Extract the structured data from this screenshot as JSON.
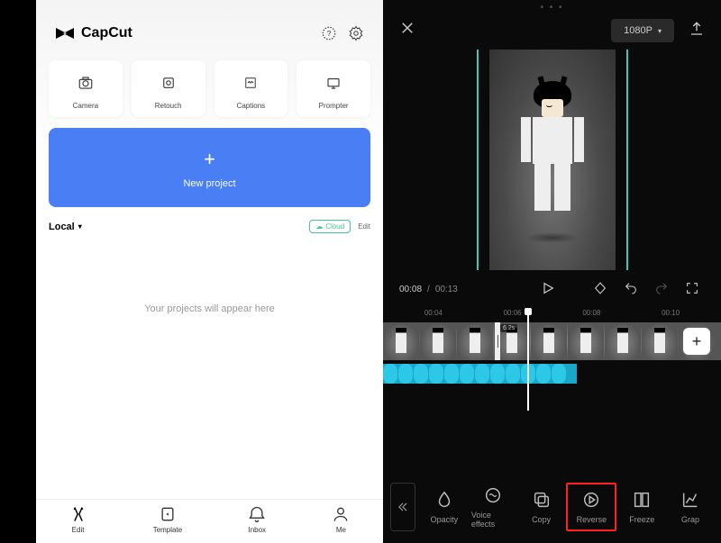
{
  "capcut": {
    "app_name": "CapCut",
    "tools": [
      {
        "label": "Camera",
        "icon": "camera-icon"
      },
      {
        "label": "Retouch",
        "icon": "retouch-icon"
      },
      {
        "label": "Captions",
        "icon": "captions-icon"
      },
      {
        "label": "Prompter",
        "icon": "prompter-icon"
      }
    ],
    "new_project_label": "New project",
    "local_label": "Local",
    "cloud_label": "Cloud",
    "edit_label": "Edit",
    "empty_message": "Your projects will appear here",
    "nav": [
      {
        "label": "Edit",
        "icon": "edit-icon"
      },
      {
        "label": "Template",
        "icon": "template-icon"
      },
      {
        "label": "Inbox",
        "icon": "inbox-icon"
      },
      {
        "label": "Me",
        "icon": "me-icon"
      }
    ]
  },
  "editor": {
    "resolution": "1080P",
    "time_current": "00:08",
    "time_total": "00:13",
    "ruler": [
      "00:04",
      "00:06",
      "00:08",
      "00:10"
    ],
    "clip_duration": "6.2s",
    "toolbar": [
      {
        "label": "Opacity",
        "icon": "opacity-icon"
      },
      {
        "label": "Voice effects",
        "icon": "voice-effects-icon"
      },
      {
        "label": "Copy",
        "icon": "copy-icon"
      },
      {
        "label": "Reverse",
        "icon": "reverse-icon",
        "highlighted": true
      },
      {
        "label": "Freeze",
        "icon": "freeze-icon"
      },
      {
        "label": "Grap",
        "icon": "graph-icon"
      }
    ]
  }
}
